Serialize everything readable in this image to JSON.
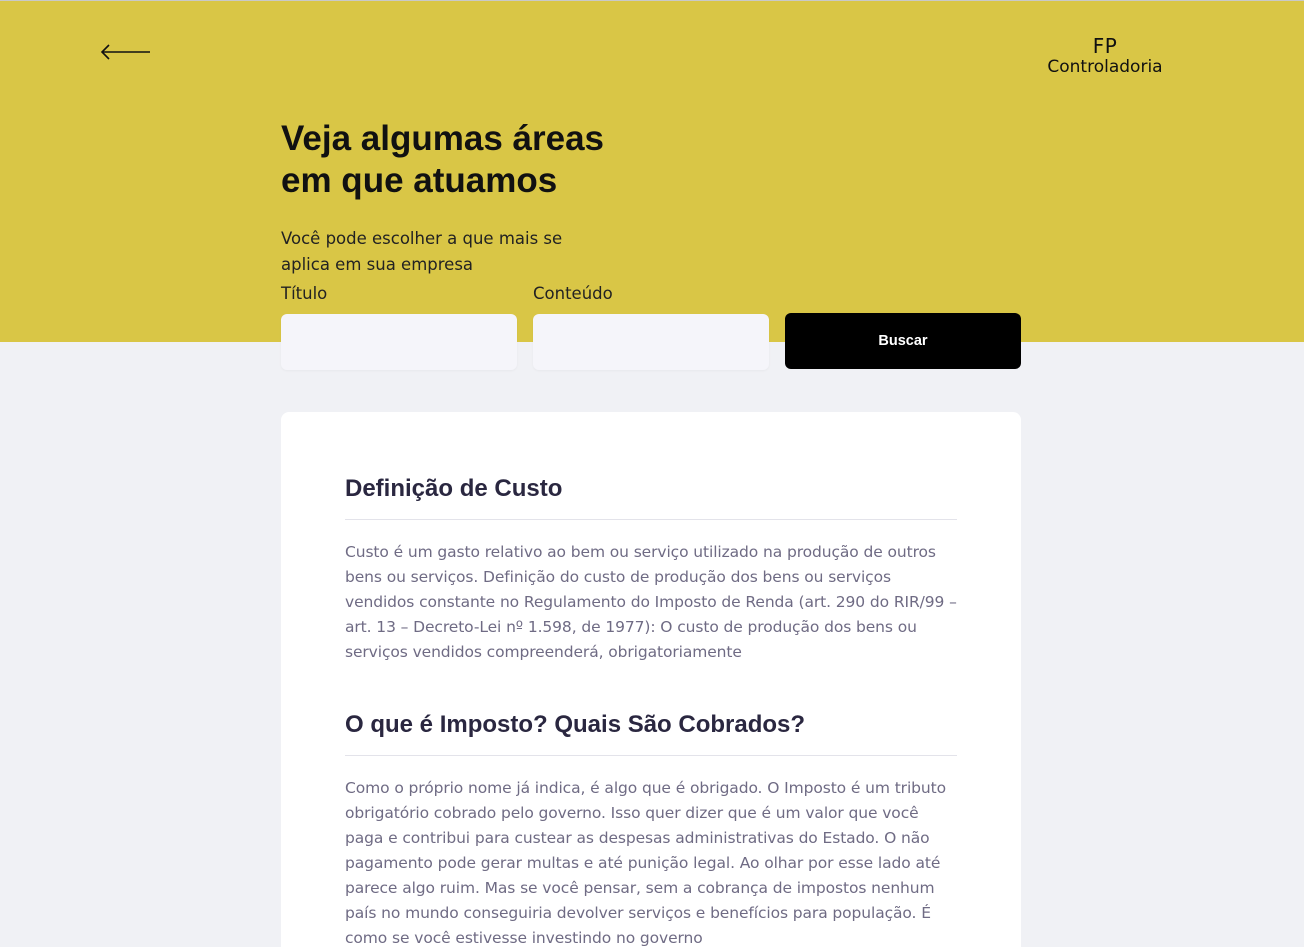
{
  "header": {
    "back_icon": "arrow-left-icon",
    "logo_line1": "FP",
    "logo_line2": "Controladoria",
    "title_line1": "Veja algumas áreas",
    "title_line2": "em que atuamos",
    "subtitle_line1": "Você pode escolher a que mais se",
    "subtitle_line2": "aplica em sua empresa"
  },
  "search": {
    "title_label": "Título",
    "title_value": "",
    "content_label": "Conteúdo",
    "content_value": "",
    "button_label": "Buscar"
  },
  "articles": [
    {
      "title": "Definição de Custo",
      "body": "Custo é um gasto relativo ao bem ou serviço utilizado na produção de outros bens ou serviços. Definição do custo de produção dos bens ou serviços vendidos constante no Regulamento do Imposto de Renda (art. 290 do RIR/99 – art. 13 – Decreto-Lei nº 1.598, de 1977): O custo de produção dos bens ou serviços vendidos compreenderá, obrigatoriamente"
    },
    {
      "title": "O que é Imposto? Quais São Cobrados?",
      "body": "Como o próprio nome já indica, é algo que é obrigado. O Imposto é um tributo obrigatório cobrado pelo governo. Isso quer dizer que é um valor que você paga e contribui para custear as despesas administrativas do Estado. O não pagamento pode gerar multas e até punição legal. Ao olhar por esse lado até parece algo ruim. Mas se você pensar, sem a cobrança de impostos nenhum país no mundo conseguiria devolver serviços e benefícios para população. É como se você estivesse investindo no governo"
    }
  ],
  "colors": {
    "hero_background": "#d9c646",
    "page_background": "#f0f1f5",
    "button_background": "#000000",
    "heading_color": "#2a2740",
    "body_text_color": "#6f6b84"
  }
}
